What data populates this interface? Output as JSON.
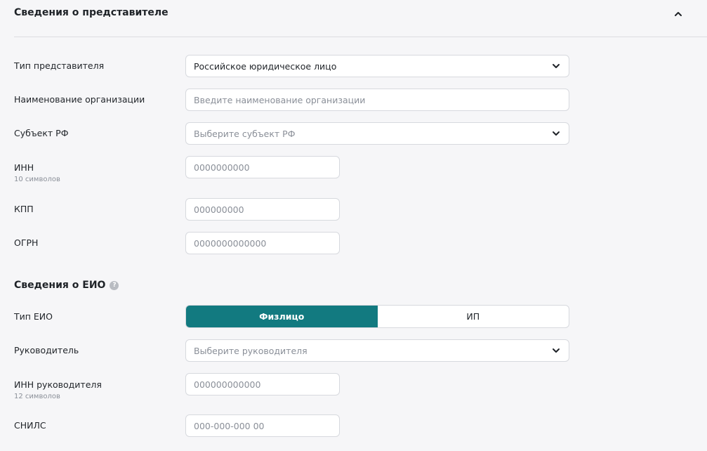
{
  "header": {
    "title": "Сведения о представителе"
  },
  "form": {
    "representative_type": {
      "label": "Тип представителя",
      "value": "Российское юридическое лицо"
    },
    "org_name": {
      "label": "Наименование организации",
      "placeholder": "Введите наименование организации"
    },
    "region": {
      "label": "Субъект РФ",
      "placeholder": "Выберите субъект РФ"
    },
    "inn": {
      "label": "ИНН",
      "hint": "10 символов",
      "placeholder": "0000000000"
    },
    "kpp": {
      "label": "КПП",
      "placeholder": "000000000"
    },
    "ogrn": {
      "label": "ОГРН",
      "placeholder": "0000000000000"
    }
  },
  "eio": {
    "title": "Сведения о ЕИО",
    "help_symbol": "?",
    "type": {
      "label": "Тип ЕИО",
      "options": [
        "Физлицо",
        "ИП"
      ],
      "selected": "Физлицо"
    },
    "head": {
      "label": "Руководитель",
      "placeholder": "Выберите руководителя"
    },
    "head_inn": {
      "label": "ИНН руководителя",
      "hint": "12 символов",
      "placeholder": "000000000000"
    },
    "snils": {
      "label": "СНИЛС",
      "placeholder": "000-000-000 00"
    }
  },
  "colors": {
    "accent": "#127a80",
    "border": "#d7d9de",
    "placeholder": "#8a8f98"
  }
}
